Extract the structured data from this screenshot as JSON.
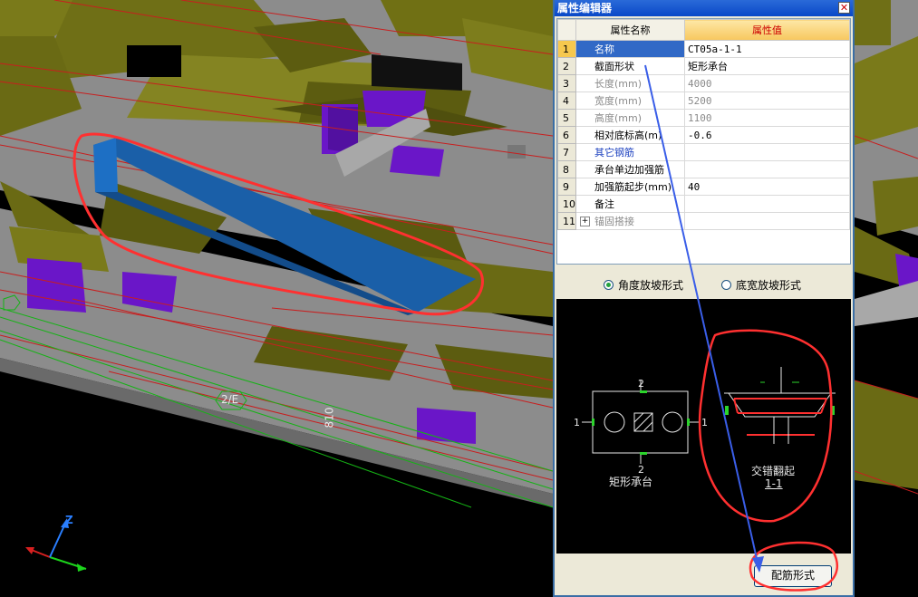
{
  "viewport": {
    "axis_label": "2/E",
    "dimension_label": "810",
    "axis_z": "Z"
  },
  "property_editor": {
    "title": "属性编辑器",
    "close_icon": "close-icon",
    "columns": [
      "属性名称",
      "属性值"
    ],
    "rows": [
      {
        "no": "1",
        "name": "名称",
        "value": "CT05a-1-1"
      },
      {
        "no": "2",
        "name": "截面形状",
        "value": "矩形承台"
      },
      {
        "no": "3",
        "name": "长度(mm)",
        "value": "4000"
      },
      {
        "no": "4",
        "name": "宽度(mm)",
        "value": "5200"
      },
      {
        "no": "5",
        "name": "高度(mm)",
        "value": "1100"
      },
      {
        "no": "6",
        "name": "相对底标高(m)",
        "value": "-0.6"
      },
      {
        "no": "7",
        "name": "其它钢筋",
        "value": ""
      },
      {
        "no": "8",
        "name": "承台单边加强筋",
        "value": ""
      },
      {
        "no": "9",
        "name": "加强筋起步(mm)",
        "value": "40"
      },
      {
        "no": "10",
        "name": "备注",
        "value": ""
      },
      {
        "no": "11",
        "name": "锚固搭接",
        "value": ""
      }
    ],
    "expander": "+",
    "radio_options": [
      {
        "label": "角度放坡形式",
        "checked": true
      },
      {
        "label": "底宽放坡形式",
        "checked": false
      }
    ],
    "diagram": {
      "plan_label": "矩形承台",
      "section_label": "交错翻起",
      "section_name": "1-1",
      "mark_top": "2",
      "mark_bottom": "2",
      "mark_left": "1",
      "mark_right": "1"
    },
    "rebar_button": "配筋形式"
  },
  "colors": {
    "title_bar": "#0a48c8",
    "selected_row": "#3169c6",
    "header_value": "#f7c75e",
    "annotation": "#ff3030",
    "arrow": "#3a5ee8"
  }
}
